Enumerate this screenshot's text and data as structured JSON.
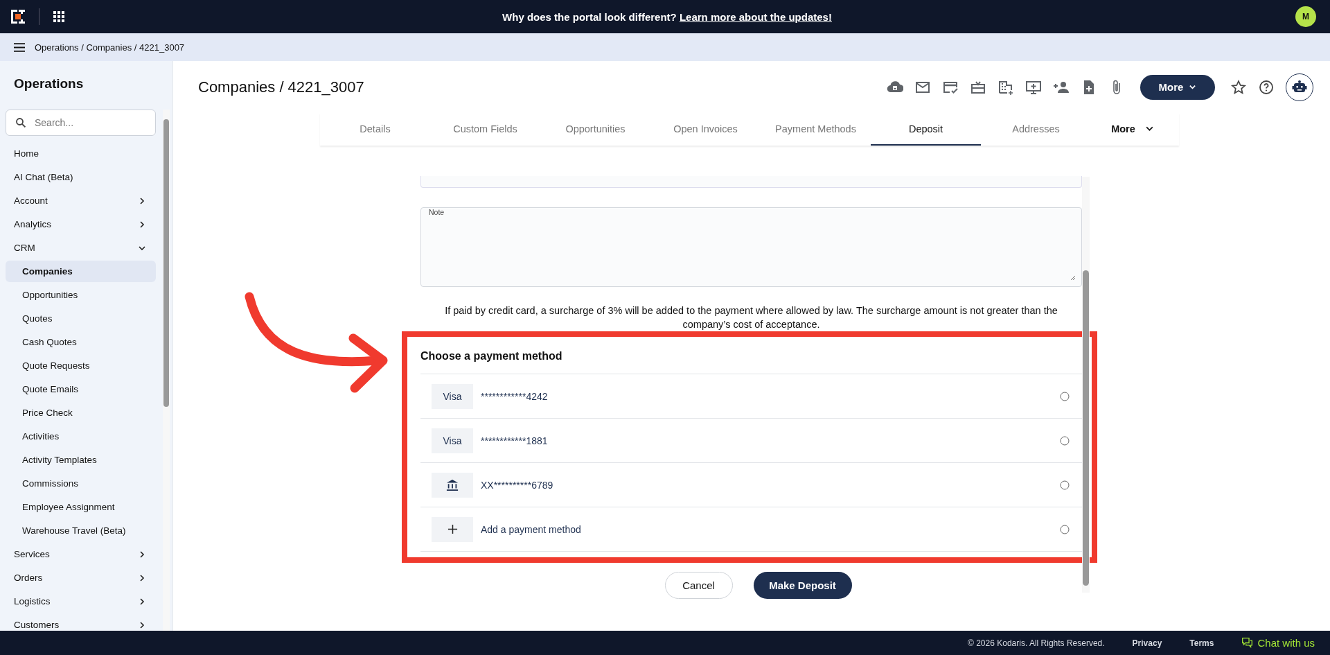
{
  "topbar": {
    "announcement": "Why does the portal look different?",
    "announcement_link": "Learn more about the updates!",
    "avatar": "M"
  },
  "breadcrumb": "Operations / Companies / 4221_3007",
  "sidebar": {
    "title": "Operations",
    "search": {
      "placeholder": "Search..."
    },
    "items": [
      {
        "kind": "link",
        "label": "Home",
        "selected": false
      },
      {
        "kind": "link",
        "label": "AI Chat (Beta)",
        "selected": false
      },
      {
        "kind": "group",
        "label": "Account",
        "expanded": false
      },
      {
        "kind": "group",
        "label": "Analytics",
        "expanded": false
      },
      {
        "kind": "group",
        "label": "CRM",
        "expanded": true,
        "children": [
          {
            "label": "Companies",
            "selected": true
          },
          {
            "label": "Opportunities",
            "selected": false
          },
          {
            "label": "Quotes",
            "selected": false
          },
          {
            "label": "Cash Quotes",
            "selected": false
          },
          {
            "label": "Quote Requests",
            "selected": false
          },
          {
            "label": "Quote Emails",
            "selected": false
          },
          {
            "label": "Price Check",
            "selected": false
          },
          {
            "label": "Activities",
            "selected": false
          },
          {
            "label": "Activity Templates",
            "selected": false
          },
          {
            "label": "Commissions",
            "selected": false
          },
          {
            "label": "Employee Assignment",
            "selected": false
          },
          {
            "label": "Warehouse Travel (Beta)",
            "selected": false
          }
        ]
      },
      {
        "kind": "group",
        "label": "Services",
        "expanded": false
      },
      {
        "kind": "group",
        "label": "Orders",
        "expanded": false
      },
      {
        "kind": "group",
        "label": "Logistics",
        "expanded": false
      },
      {
        "kind": "group",
        "label": "Customers",
        "expanded": false
      }
    ]
  },
  "page_title": "Companies / 4221_3007",
  "more_button": "More",
  "tabs": [
    {
      "kind": "tab",
      "label": "Details",
      "selected": false
    },
    {
      "kind": "tab",
      "label": "Custom Fields",
      "selected": false
    },
    {
      "kind": "tab",
      "label": "Opportunities",
      "selected": false
    },
    {
      "kind": "tab",
      "label": "Open Invoices",
      "selected": false
    },
    {
      "kind": "tab",
      "label": "Payment Methods",
      "selected": false
    },
    {
      "kind": "tab",
      "label": "Deposit",
      "selected": true
    },
    {
      "kind": "tab",
      "label": "Addresses",
      "selected": false
    },
    {
      "kind": "menu",
      "label": "More",
      "selected": false
    }
  ],
  "form": {
    "note": {
      "label": "Note"
    },
    "disclaimer": "If paid by credit card, a surcharge of 3% will be added to the payment where allowed by law. The surcharge amount is not greater than the company’s cost of acceptance.",
    "payment": {
      "title": "Choose a payment method",
      "options": [
        {
          "kind": "card",
          "badge": "Visa",
          "label": "************4242",
          "selected": false
        },
        {
          "kind": "card",
          "badge": "Visa",
          "label": "************1881",
          "selected": false
        },
        {
          "kind": "bank",
          "label": "XX**********6789",
          "selected": false
        },
        {
          "kind": "add",
          "label": "Add a payment method",
          "selected": false
        }
      ]
    },
    "cancel": "Cancel",
    "submit": "Make Deposit"
  },
  "footer": {
    "copyright": "© 2026 Kodaris. All Rights Reserved.",
    "links": [
      "Privacy",
      "Terms"
    ],
    "chat": "Chat with us"
  }
}
